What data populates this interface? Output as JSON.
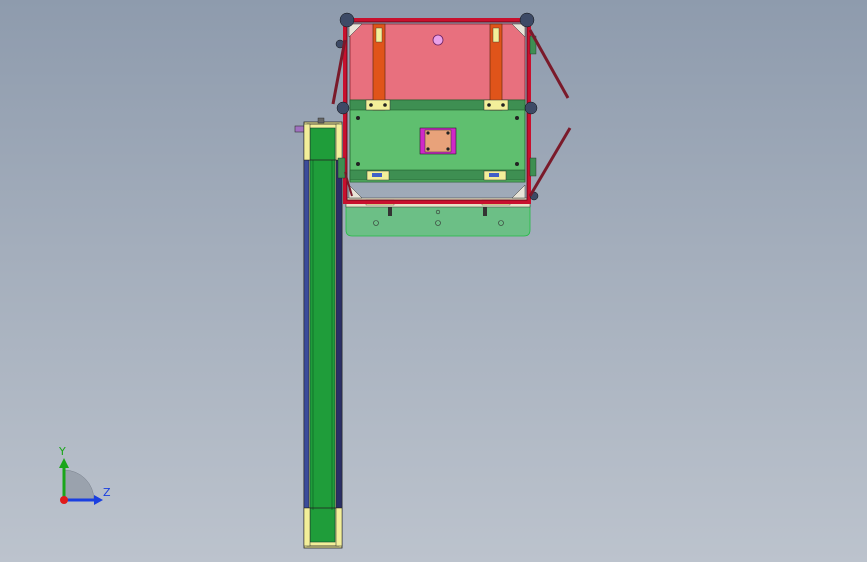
{
  "viewport": {
    "background_top": "#8e9bad",
    "background_bottom": "#bcc3cd"
  },
  "triad": {
    "y_label": "Y",
    "z_label": "Z",
    "y_color": "#1aa61a",
    "z_color": "#1a3fe0",
    "x_color": "#e01a1a"
  },
  "model": {
    "frame_color": "#c8102e",
    "upper_panel_color": "#e8707e",
    "lower_panel_color": "#5fbf6f",
    "base_plate_color": "#6cbf86",
    "conveyor_belt_color": "#1f9d3a",
    "roller_color": "#f0e68c",
    "bracket_color": "#e05a1a",
    "pad_color": "#e8a27a",
    "pad_border_color": "#d020c0"
  }
}
